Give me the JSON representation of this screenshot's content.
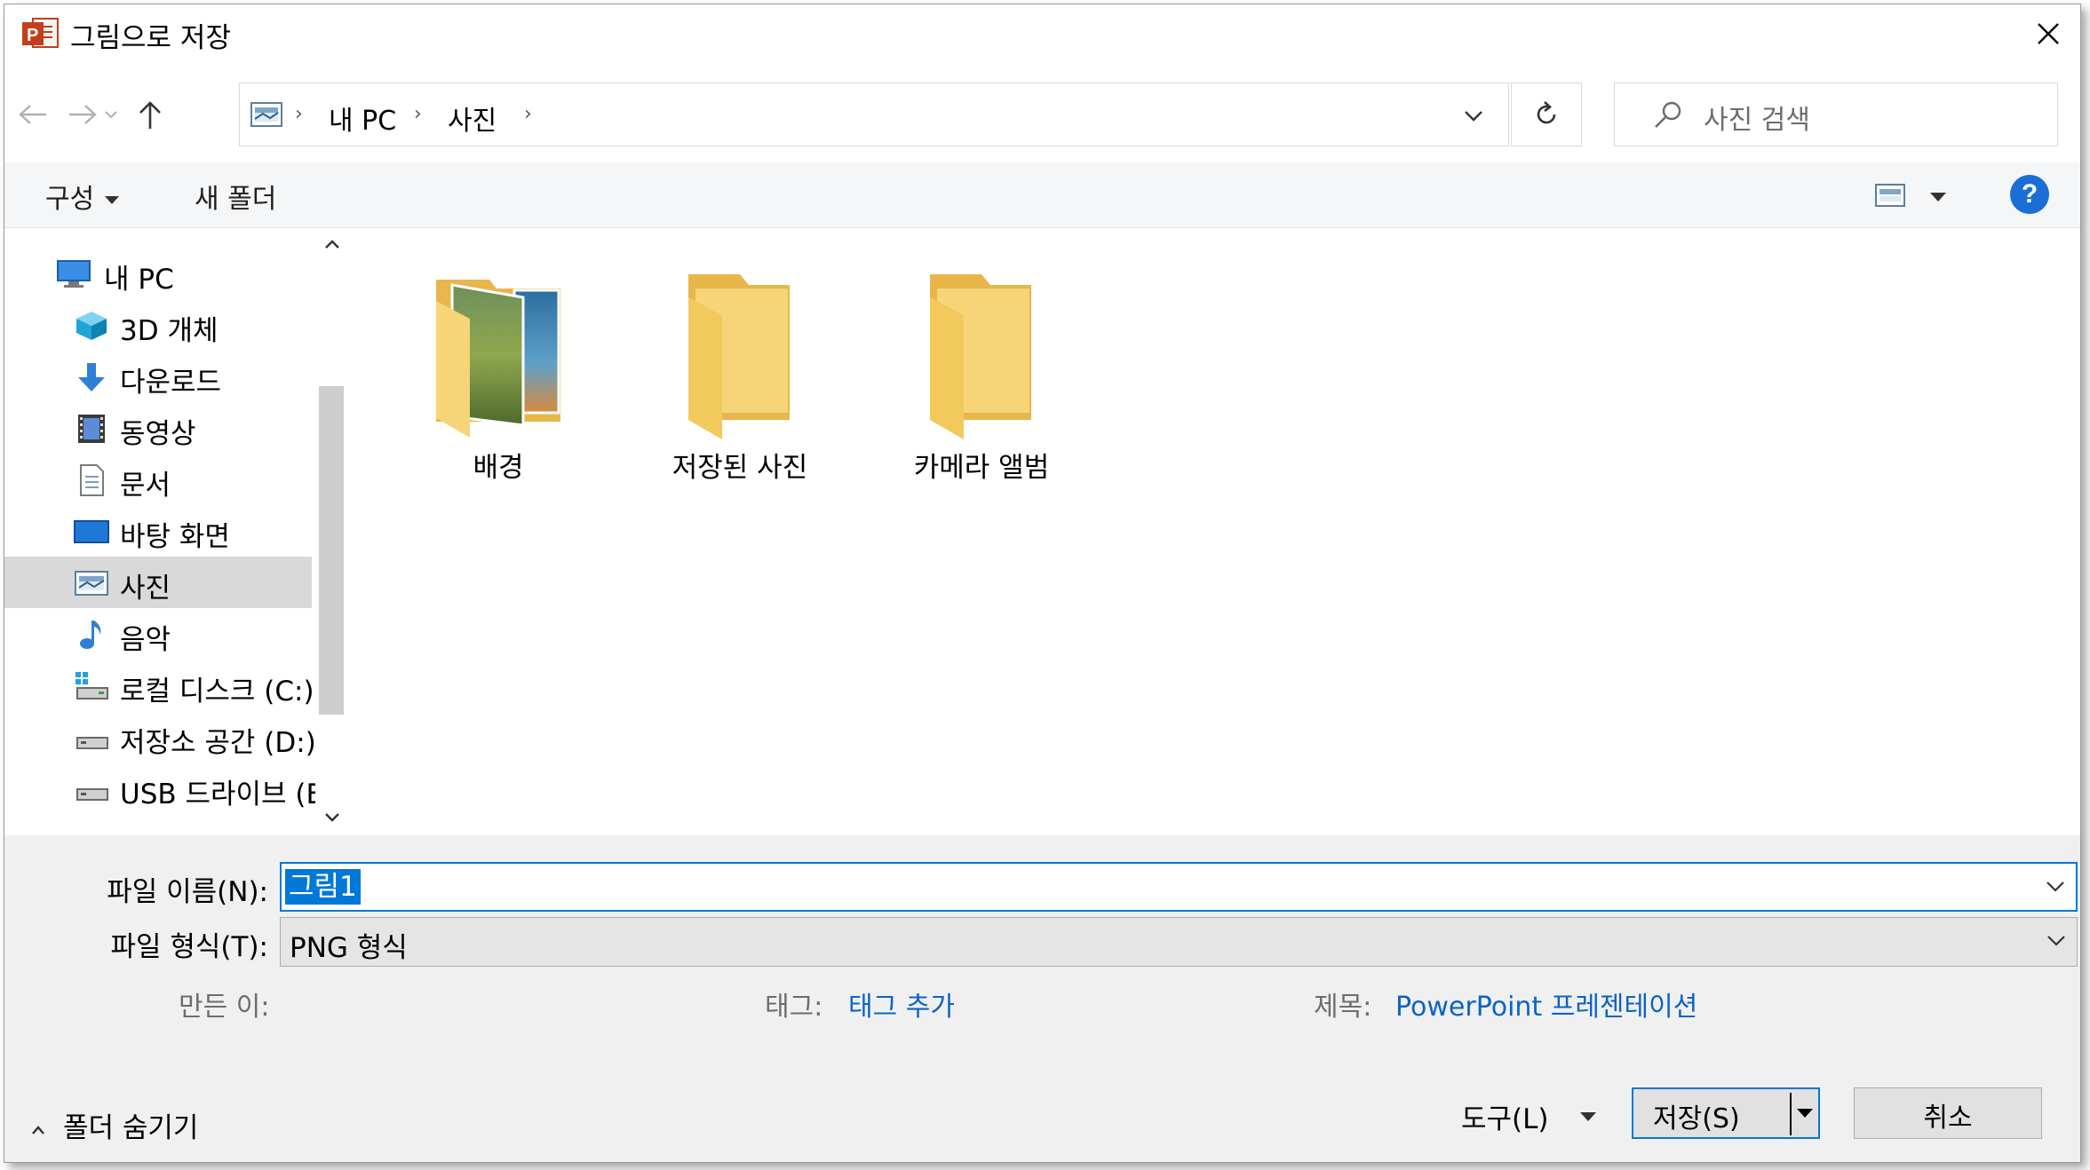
{
  "window": {
    "title": "그림으로 저장",
    "app_icon": "powerpoint-icon"
  },
  "address": {
    "crumbs": [
      "내 PC",
      "사진"
    ],
    "search_placeholder": "사진 검색"
  },
  "toolbar": {
    "organize": "구성",
    "new_folder": "새 폴더"
  },
  "sidebar": {
    "items": [
      {
        "label": "내 PC",
        "icon": "pc-icon"
      },
      {
        "label": "3D 개체",
        "icon": "cube-icon"
      },
      {
        "label": "다운로드",
        "icon": "download-icon"
      },
      {
        "label": "동영상",
        "icon": "video-icon"
      },
      {
        "label": "문서",
        "icon": "document-icon"
      },
      {
        "label": "바탕 화면",
        "icon": "desktop-icon"
      },
      {
        "label": "사진",
        "icon": "pictures-icon"
      },
      {
        "label": "음악",
        "icon": "music-icon"
      },
      {
        "label": "로컬 디스크 (C:)",
        "icon": "drive-icon"
      },
      {
        "label": "저장소 공간 (D:)",
        "icon": "drive-icon"
      },
      {
        "label": "USB 드라이브 (E",
        "icon": "usb-drive-icon"
      }
    ],
    "selected": "사진"
  },
  "folders": [
    {
      "label": "배경",
      "icon": "folder-with-photos-icon"
    },
    {
      "label": "저장된 사진",
      "icon": "folder-icon"
    },
    {
      "label": "카메라 앨범",
      "icon": "folder-icon"
    }
  ],
  "form": {
    "filename_label": "파일 이름(N):",
    "filename_value": "그림1",
    "filetype_label": "파일 형식(T):",
    "filetype_value": "PNG 형식",
    "author_label": "만든 이:",
    "tags_label": "태그:",
    "tags_value": "태그 추가",
    "title_label": "제목:",
    "title_value": "PowerPoint 프레젠테이션"
  },
  "footer": {
    "hide_folders": "폴더 숨기기",
    "tools": "도구(L)",
    "save": "저장(S)",
    "cancel": "취소"
  },
  "colors": {
    "accent": "#0078d7",
    "link": "#0b63c4",
    "selected_row": "#d9d9d9",
    "folder": "#f7d478"
  }
}
